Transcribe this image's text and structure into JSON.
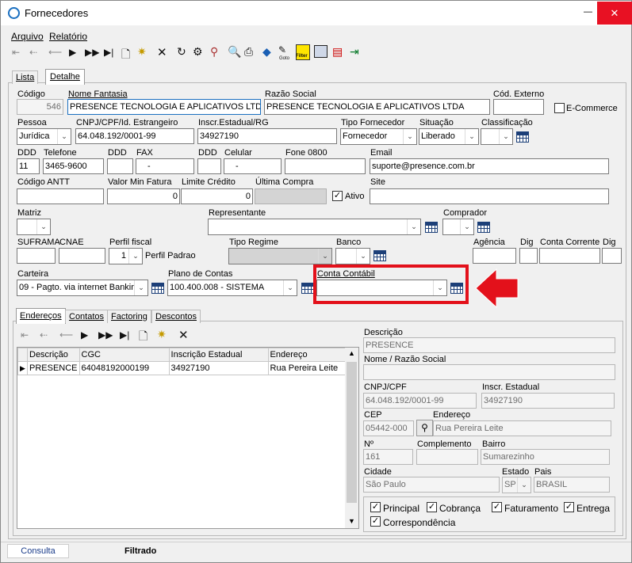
{
  "window": {
    "title": "Fornecedores",
    "minimize": "—",
    "close": "✕"
  },
  "menu": {
    "file": "Arquivo",
    "report": "Relatório"
  },
  "toolbar": {
    "goto": "Goto",
    "filter": "Filter"
  },
  "tabs": {
    "list": "Lista",
    "detail": "Detalhe"
  },
  "form": {
    "codigo": {
      "label": "Código",
      "value": "546"
    },
    "nome_fantasia": {
      "label": "Nome Fantasia",
      "value": "PRESENCE TECNOLOGIA E APLICATIVOS LTDA"
    },
    "razao_social": {
      "label": "Razão Social",
      "value": "PRESENCE TECNOLOGIA E APLICATIVOS LTDA"
    },
    "cod_externo": {
      "label": "Cód. Externo",
      "value": ""
    },
    "ecommerce": {
      "label": "E-Commerce"
    },
    "pessoa": {
      "label": "Pessoa",
      "value": "Jurídica"
    },
    "cnpj": {
      "label": "CNPJ/CPF/Id. Estrangeiro",
      "value": "64.048.192/0001-99"
    },
    "inscr": {
      "label": "Inscr.Estadual/RG",
      "value": "34927190"
    },
    "tipo_fornecedor": {
      "label": "Tipo Fornecedor",
      "value": "Fornecedor"
    },
    "situacao": {
      "label": "Situação",
      "value": "Liberado"
    },
    "classificacao": {
      "label": "Classificação",
      "value": ""
    },
    "ddd1": {
      "label": "DDD",
      "value": "11"
    },
    "telefone": {
      "label": "Telefone",
      "value": "3465-9600"
    },
    "ddd2": {
      "label": "DDD",
      "value": ""
    },
    "fax": {
      "label": "FAX",
      "value": "-"
    },
    "ddd3": {
      "label": "DDD",
      "value": ""
    },
    "celular": {
      "label": "Celular",
      "value": "-"
    },
    "fone0800": {
      "label": "Fone 0800",
      "value": ""
    },
    "email": {
      "label": "Email",
      "value": "suporte@presence.com.br"
    },
    "antt": {
      "label": "Código ANTT",
      "value": ""
    },
    "valor_min": {
      "label": "Valor Min Fatura",
      "value": "0"
    },
    "limite": {
      "label": "Limite Crédito",
      "value": "0"
    },
    "ultima_compra": {
      "label": "Última Compra",
      "value": ""
    },
    "ativo": {
      "label": "Ativo"
    },
    "site": {
      "label": "Site",
      "value": ""
    },
    "matriz": {
      "label": "Matriz",
      "value": ""
    },
    "representante": {
      "label": "Representante",
      "value": ""
    },
    "comprador": {
      "label": "Comprador",
      "value": ""
    },
    "suframa": {
      "label": "SUFRAMA",
      "value": ""
    },
    "cnae": {
      "label": "CNAE",
      "value": ""
    },
    "perfil_fiscal": {
      "label": "Perfil fiscal",
      "value": "1",
      "desc": "Perfil Padrao"
    },
    "tipo_regime": {
      "label": "Tipo Regime",
      "value": ""
    },
    "banco": {
      "label": "Banco",
      "value": ""
    },
    "agencia": {
      "label": "Agência",
      "value": ""
    },
    "dig1": {
      "label": "Dig",
      "value": ""
    },
    "conta_corrente": {
      "label": "Conta Corrente",
      "value": ""
    },
    "dig2": {
      "label": "Dig",
      "value": ""
    },
    "carteira": {
      "label": "Carteira",
      "value": "09 - Pagto. via internet Bankin"
    },
    "plano_contas": {
      "label": "Plano de Contas",
      "value": "100.400.008 - SISTEMA"
    },
    "conta_contabil": {
      "label": "Conta Contábil",
      "value": ""
    }
  },
  "subtabs": {
    "enderecos": "Endereços",
    "contatos": "Contatos",
    "factoring": "Factoring",
    "descontos": "Descontos"
  },
  "grid": {
    "headers": [
      "Descrição",
      "CGC",
      "Inscrição Estadual",
      "Endereço"
    ],
    "row": [
      "PRESENCE",
      "64048192000199",
      "34927190",
      "Rua Pereira Leite"
    ]
  },
  "address": {
    "descricao": {
      "label": "Descrição",
      "value": "PRESENCE"
    },
    "nome": {
      "label": "Nome / Razão Social",
      "value": ""
    },
    "cnpj": {
      "label": "CNPJ/CPF",
      "value": "64.048.192/0001-99"
    },
    "inscr": {
      "label": "Inscr. Estadual",
      "value": "34927190"
    },
    "cep": {
      "label": "CEP",
      "value": "05442-000"
    },
    "endereco": {
      "label": "Endereço",
      "value": "Rua Pereira Leite"
    },
    "numero": {
      "label": "Nº",
      "value": "161"
    },
    "complemento": {
      "label": "Complemento",
      "value": ""
    },
    "bairro": {
      "label": "Bairro",
      "value": "Sumarezinho"
    },
    "cidade": {
      "label": "Cidade",
      "value": "São Paulo"
    },
    "estado": {
      "label": "Estado",
      "value": "SP"
    },
    "pais": {
      "label": "Pais",
      "value": "BRASIL"
    },
    "principal": "Principal",
    "cobranca": "Cobrança",
    "faturamento": "Faturamento",
    "entrega": "Entrega",
    "correspondencia": "Correspondência"
  },
  "status": {
    "consulta": "Consulta",
    "filtrado": "Filtrado"
  },
  "colors": {
    "highlight": "#e3111b",
    "accent": "#1c3f78"
  }
}
